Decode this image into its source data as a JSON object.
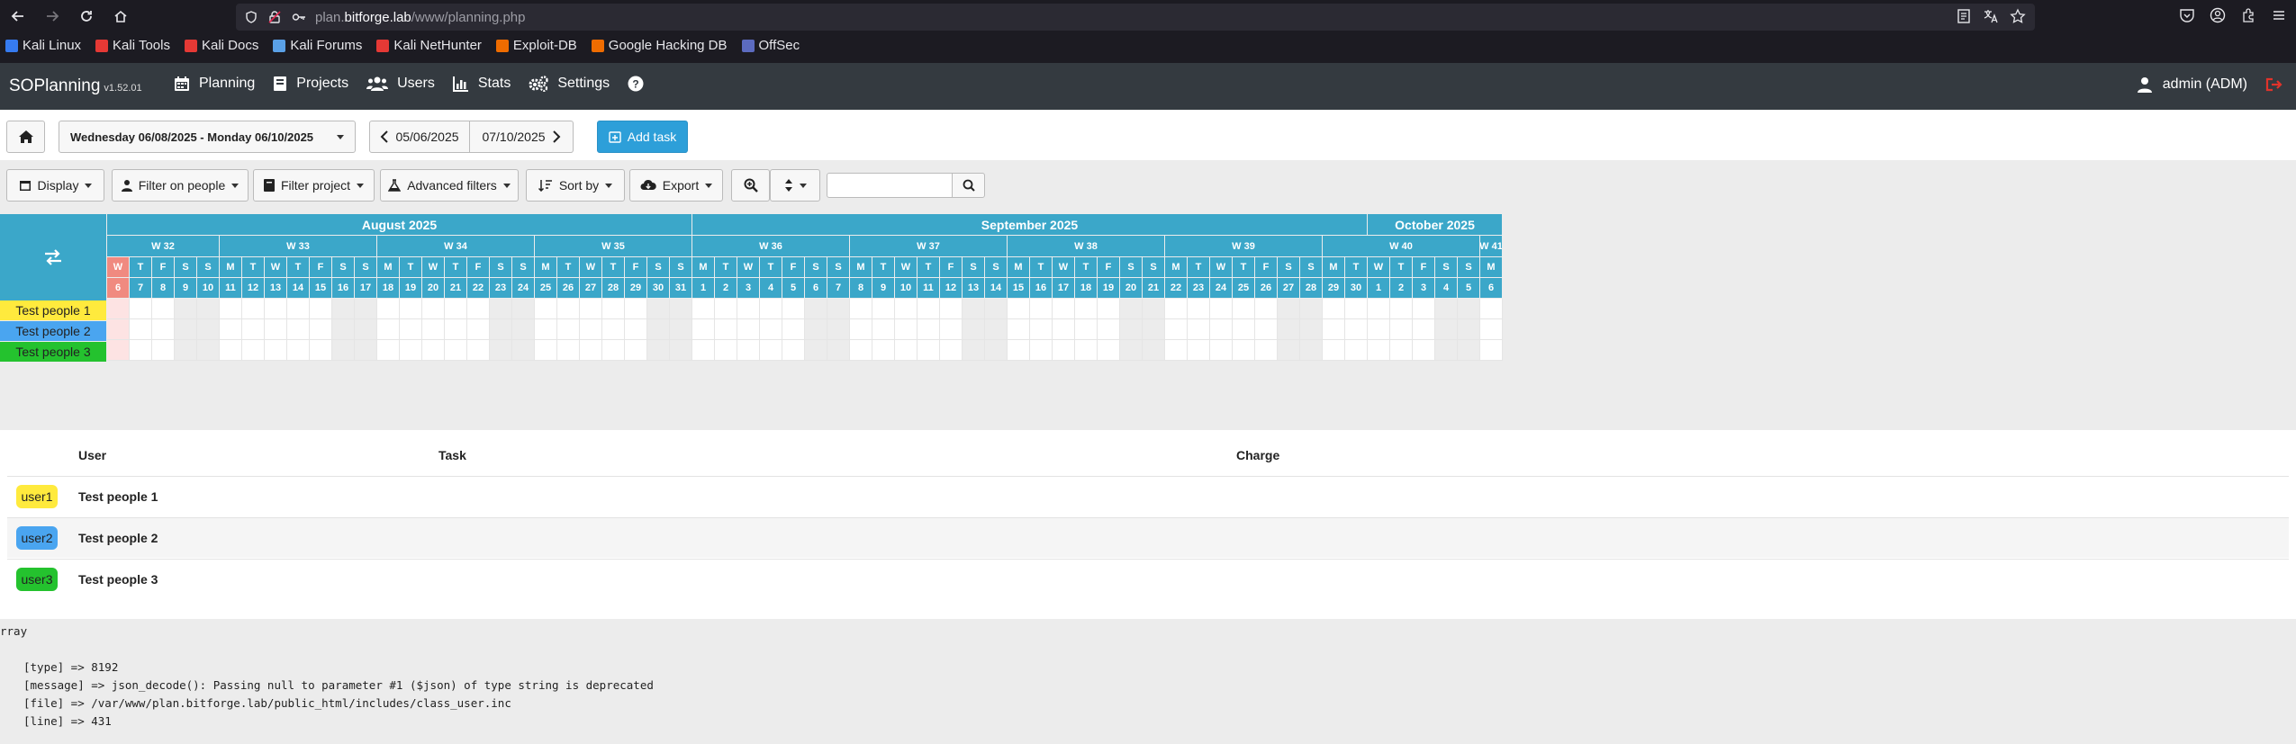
{
  "browser": {
    "url_prefix": "plan.",
    "url_host": "bitforge.lab",
    "url_path": "/www/planning.php",
    "bookmarks": [
      {
        "label": "Kali Linux",
        "color": "#367bf0"
      },
      {
        "label": "Kali Tools",
        "color": "#e53935"
      },
      {
        "label": "Kali Docs",
        "color": "#e53935"
      },
      {
        "label": "Kali Forums",
        "color": "#5aa0e6"
      },
      {
        "label": "Kali NetHunter",
        "color": "#e53935"
      },
      {
        "label": "Exploit-DB",
        "color": "#ef6c00"
      },
      {
        "label": "Google Hacking DB",
        "color": "#ef6c00"
      },
      {
        "label": "OffSec",
        "color": "#5c6bc0"
      }
    ]
  },
  "app": {
    "brand": "SOPlanning",
    "version": "v1.52.01",
    "menu": [
      {
        "label": "Planning",
        "icon": "calendar-icon"
      },
      {
        "label": "Projects",
        "icon": "book-icon"
      },
      {
        "label": "Users",
        "icon": "users-icon"
      },
      {
        "label": "Stats",
        "icon": "bar-chart-icon"
      },
      {
        "label": "Settings",
        "icon": "gears-icon"
      }
    ],
    "user": "admin (ADM)"
  },
  "toolbar": {
    "date_range": "Wednesday 06/08/2025 - Monday 06/10/2025",
    "start_date": "05/06/2025",
    "end_date": "07/10/2025",
    "add_task": "Add task",
    "display": "Display",
    "filter_people": "Filter on people",
    "filter_project": "Filter project",
    "advanced_filters": "Advanced filters",
    "sort_by": "Sort by",
    "export": "Export",
    "search_value": ""
  },
  "planning": {
    "months": [
      {
        "label": "August 2025",
        "days": 26
      },
      {
        "label": "September 2025",
        "days": 30
      },
      {
        "label": "October 2025",
        "days": 6
      }
    ],
    "weeks": [
      {
        "label": "W 32",
        "days": 5
      },
      {
        "label": "W 33",
        "days": 7
      },
      {
        "label": "W 34",
        "days": 7
      },
      {
        "label": "W 35",
        "days": 7
      },
      {
        "label": "W 36",
        "days": 7
      },
      {
        "label": "W 37",
        "days": 7
      },
      {
        "label": "W 38",
        "days": 7
      },
      {
        "label": "W 39",
        "days": 7
      },
      {
        "label": "W 40",
        "days": 7
      },
      {
        "label": "W 41",
        "days": 1
      }
    ],
    "first_weekday_index": 2,
    "day_letters": [
      "M",
      "T",
      "W",
      "T",
      "F",
      "S",
      "S"
    ],
    "days": [
      "6",
      "7",
      "8",
      "9",
      "10",
      "11",
      "12",
      "13",
      "14",
      "15",
      "16",
      "17",
      "18",
      "19",
      "20",
      "21",
      "22",
      "23",
      "24",
      "25",
      "26",
      "27",
      "28",
      "29",
      "30",
      "31",
      "1",
      "2",
      "3",
      "4",
      "5",
      "6",
      "7",
      "8",
      "9",
      "10",
      "11",
      "12",
      "13",
      "14",
      "15",
      "16",
      "17",
      "18",
      "19",
      "20",
      "21",
      "22",
      "23",
      "24",
      "25",
      "26",
      "27",
      "28",
      "29",
      "30",
      "1",
      "2",
      "3",
      "4",
      "5",
      "6"
    ],
    "today_index": 0,
    "today_color": "#f08a80",
    "people": [
      {
        "label": "Test people 1",
        "color": "#ffea3d"
      },
      {
        "label": "Test people 2",
        "color": "#4aa5f0"
      },
      {
        "label": "Test people 3",
        "color": "#24c22e"
      }
    ]
  },
  "table": {
    "headers": {
      "user": "User",
      "task": "Task",
      "charge": "Charge"
    },
    "rows": [
      {
        "badge": "user1",
        "name": "Test people 1",
        "color": "#ffea3d"
      },
      {
        "badge": "user2",
        "name": "Test people 2",
        "color": "#4aa5f0"
      },
      {
        "badge": "user3",
        "name": "Test people 3",
        "color": "#24c22e"
      }
    ]
  },
  "debug": {
    "title": "rray",
    "lines": [
      "[type] => 8192",
      "[message] => json_decode(): Passing null to parameter #1 ($json) of type string is deprecated",
      "[file] => /var/www/plan.bitforge.lab/public_html/includes/class_user.inc",
      "[line] => 431"
    ]
  }
}
